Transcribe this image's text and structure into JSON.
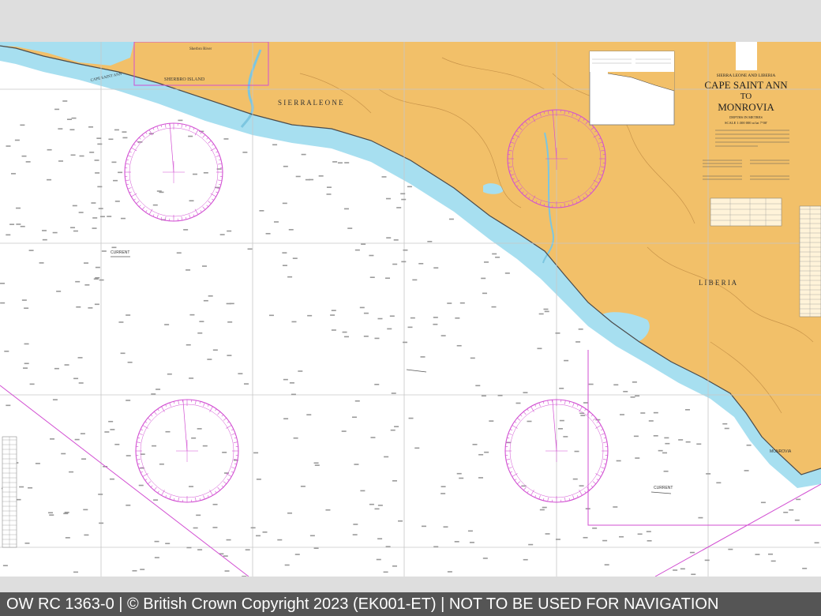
{
  "chart": {
    "region": "SIERRA LEONE AND LIBERIA",
    "title_lines": [
      "CAPE SAINT ANN",
      "TO",
      "MONROVIA"
    ],
    "depths_note": "DEPTHS IN METRES",
    "scale_note": "SCALE 1:300 000 at lat 7°00'"
  },
  "labels": {
    "sierra_leone": "S I E R R A   L E O N E",
    "liberia": "L I B E R I A",
    "sherbro_island": "SHERBRO ISLAND",
    "cape_saint_ann": "CAPE SAINT ANN",
    "sherbro_river": "Sherbro River",
    "current_1": "CURRENT",
    "current_2": "CURRENT",
    "monrovia": "MONROVIA"
  },
  "colors": {
    "land": "#f2c069",
    "shallow": "#a7dff0",
    "sea": "#ffffff",
    "compass": "#d24fd2",
    "gridline": "#c7c7c7",
    "coast": "#4b4b4b"
  },
  "footer": {
    "text": "OW RC 1363-0 | © British Crown Copyright 2023 (EK001-ET) | NOT TO BE USED FOR NAVIGATION"
  }
}
